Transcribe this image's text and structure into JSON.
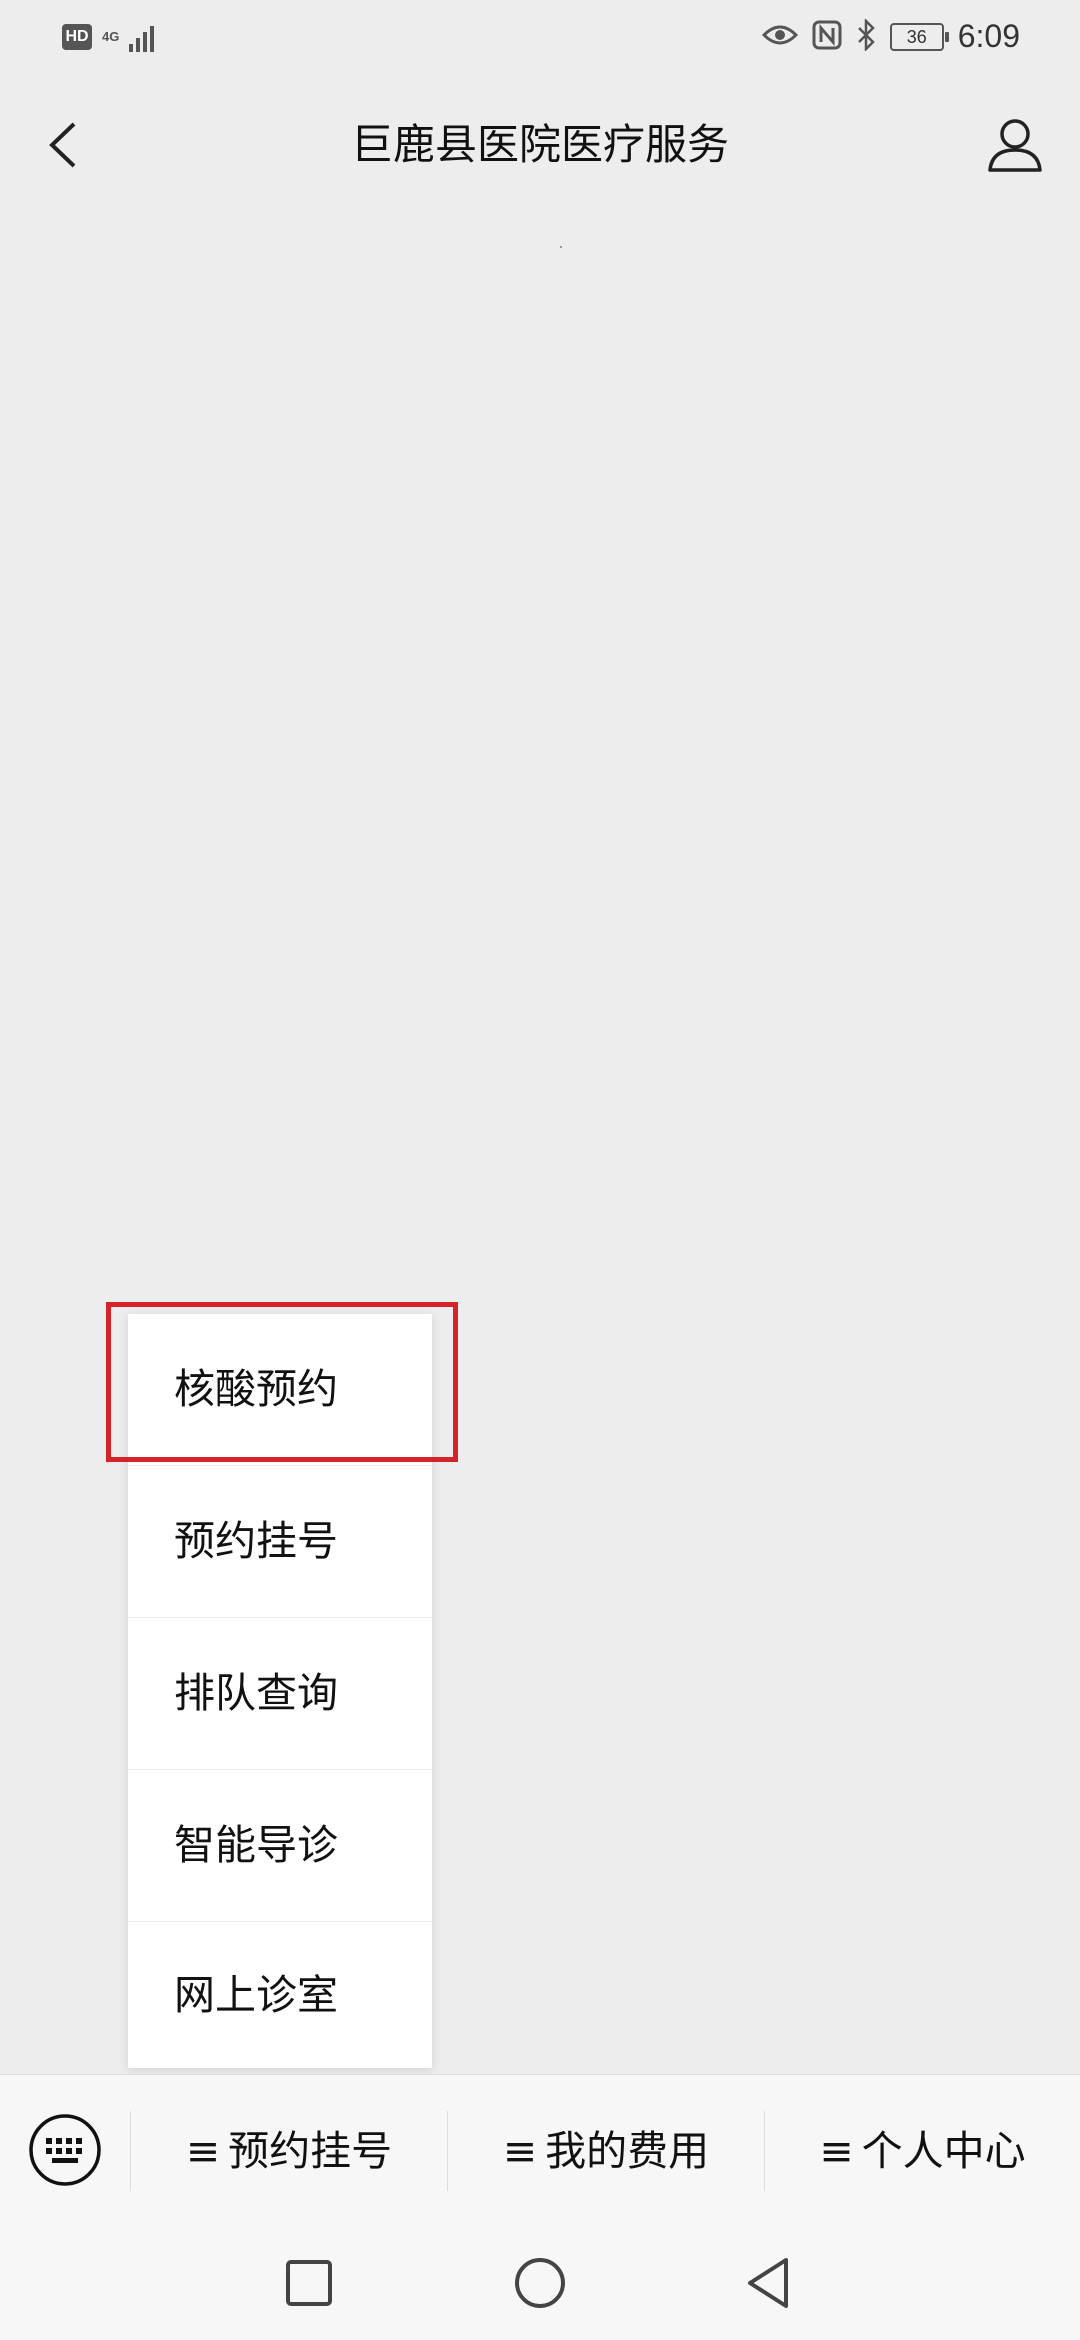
{
  "status_bar": {
    "hd": "HD",
    "network": "4G",
    "battery": "36",
    "time": "6:09"
  },
  "nav": {
    "title": "巨鹿县医院医疗服务"
  },
  "popup_menu": {
    "items": [
      {
        "label": "核酸预约"
      },
      {
        "label": "预约挂号"
      },
      {
        "label": "排队查询"
      },
      {
        "label": "智能导诊"
      },
      {
        "label": "网上诊室"
      }
    ],
    "highlight_color": "#d5232a"
  },
  "bottom_menu": {
    "tabs": [
      {
        "label": "预约挂号"
      },
      {
        "label": "我的费用"
      },
      {
        "label": "个人中心"
      }
    ]
  },
  "icons": {
    "back": "back-chevron-icon",
    "profile": "person-icon",
    "keyboard": "keyboard-icon",
    "menu_bars": "≡"
  }
}
